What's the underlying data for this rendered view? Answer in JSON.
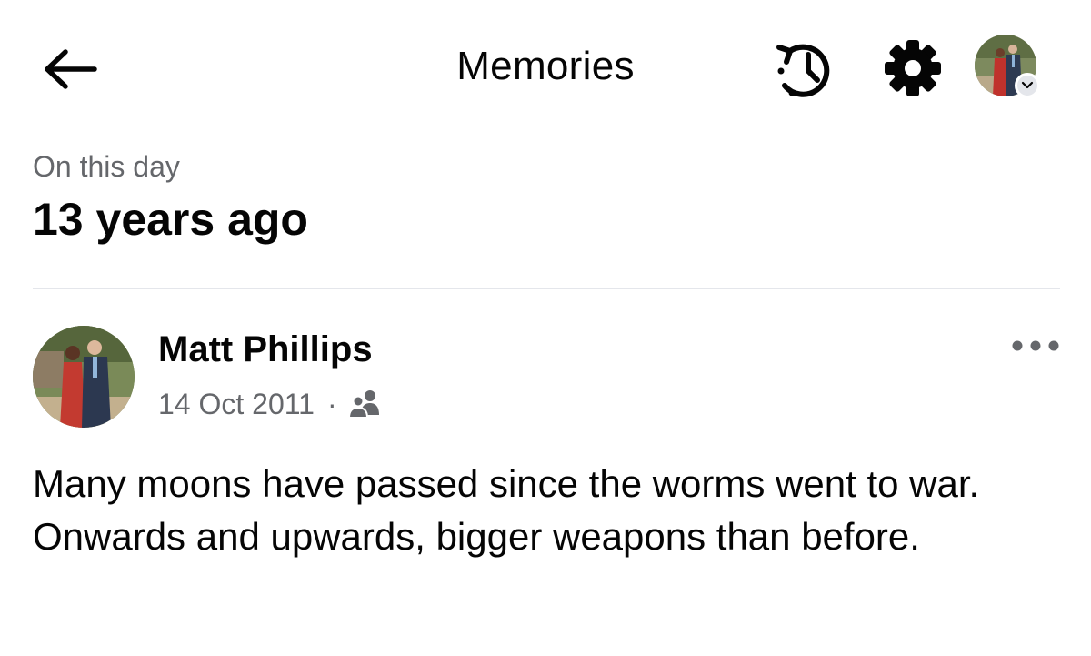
{
  "header": {
    "title": "Memories",
    "back_icon": "arrow-left-icon",
    "history_icon": "history-clock-icon",
    "settings_icon": "gear-icon",
    "profile_chevron_icon": "chevron-down-icon"
  },
  "memory": {
    "subtitle": "On this day",
    "title": "13 years ago"
  },
  "post": {
    "author": "Matt Phillips",
    "date": "14 Oct 2011",
    "separator": "·",
    "audience_icon": "friends-icon",
    "more_icon": "more-dots-icon",
    "text": "Many moons have passed since the worms went to war. Onwards and upwards, bigger weapons than before."
  },
  "colors": {
    "text_primary": "#050505",
    "text_secondary": "#65676b",
    "divider": "#e4e6eb",
    "background": "#ffffff"
  }
}
